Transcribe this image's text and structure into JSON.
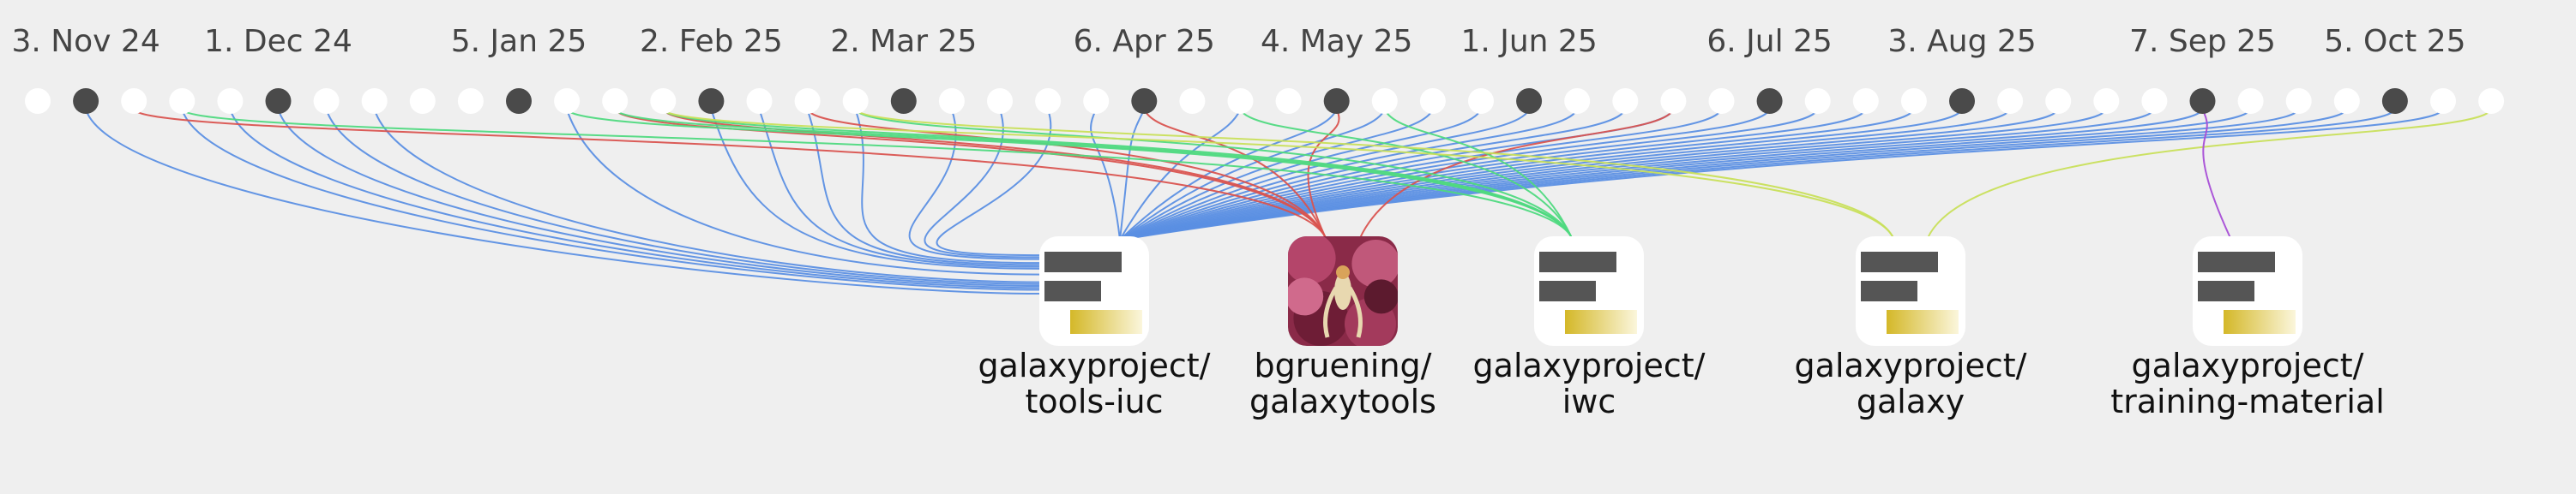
{
  "timeline": {
    "ticks": [
      {
        "label": "3. Nov 24",
        "dot": 1
      },
      {
        "label": "1. Dec 24",
        "dot": 5
      },
      {
        "label": "5. Jan 25",
        "dot": 10
      },
      {
        "label": "2. Feb 25",
        "dot": 14
      },
      {
        "label": "2. Mar 25",
        "dot": 18
      },
      {
        "label": "6. Apr 25",
        "dot": 23
      },
      {
        "label": "4. May 25",
        "dot": 27
      },
      {
        "label": "1. Jun 25",
        "dot": 31
      },
      {
        "label": "6. Jul 25",
        "dot": 36
      },
      {
        "label": "3. Aug 25",
        "dot": 40
      },
      {
        "label": "7. Sep 25",
        "dot": 45
      },
      {
        "label": "5. Oct 25",
        "dot": 49
      }
    ],
    "dot_count": 52,
    "dark_dots": [
      1,
      5,
      10,
      14,
      18,
      23,
      27,
      31,
      36,
      40,
      45,
      49
    ]
  },
  "repositories": [
    {
      "line1": "galaxyproject/",
      "line2": "tools-iuc",
      "icon": "repo-icon",
      "color": "#5b8fe3"
    },
    {
      "line1": "bgruening/",
      "line2": "galaxytools",
      "icon": "avatar-photo",
      "color": "#d9534f"
    },
    {
      "line1": "galaxyproject/",
      "line2": "iwc",
      "icon": "repo-icon",
      "color": "#4fd97f"
    },
    {
      "line1": "galaxyproject/",
      "line2": "galaxy",
      "icon": "repo-icon",
      "color": "#c8df5a"
    },
    {
      "line1": "galaxyproject/",
      "line2": "training-material",
      "icon": "repo-icon",
      "color": "#a64dd6"
    }
  ],
  "connections": [
    {
      "repo": 0,
      "dots": [
        1,
        3,
        4,
        5,
        6,
        7,
        11,
        14,
        15,
        16,
        17,
        19,
        20,
        21,
        22,
        23,
        25,
        27,
        28,
        29,
        30,
        31,
        32,
        33,
        34,
        35,
        36,
        37,
        38,
        39,
        40,
        41,
        42,
        43,
        44,
        45,
        46,
        47,
        48,
        49,
        50
      ]
    },
    {
      "repo": 1,
      "dots": [
        2,
        12,
        13,
        16,
        23,
        27,
        34
      ]
    },
    {
      "repo": 2,
      "dots": [
        3,
        11,
        12,
        13,
        17,
        25,
        28
      ]
    },
    {
      "repo": 3,
      "dots": [
        13,
        17,
        51
      ]
    },
    {
      "repo": 4,
      "dots": [
        45
      ]
    }
  ]
}
